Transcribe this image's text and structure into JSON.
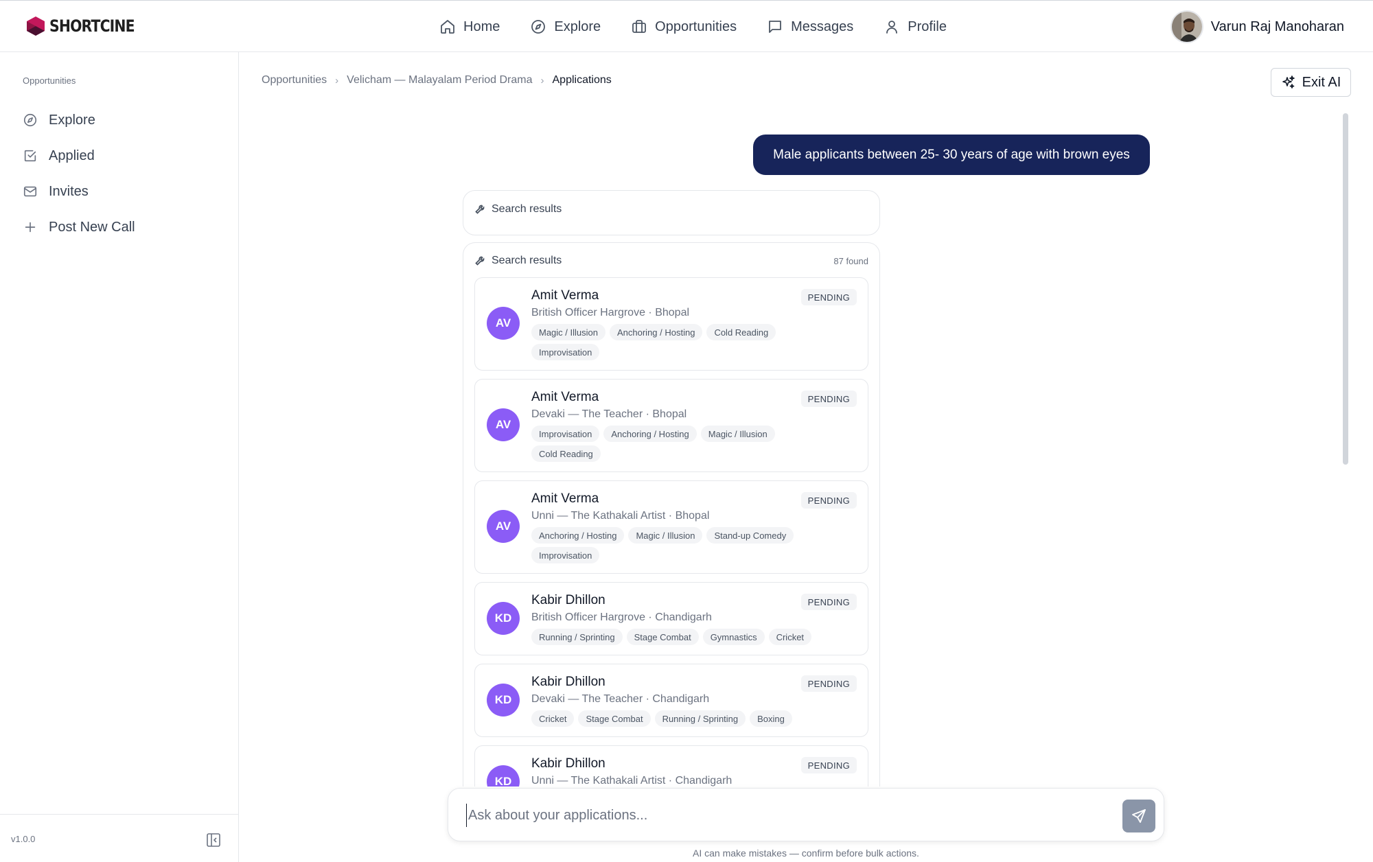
{
  "brand": {
    "name": "SHORTCINE"
  },
  "nav": {
    "items": [
      {
        "label": "Home",
        "icon": "home-icon"
      },
      {
        "label": "Explore",
        "icon": "compass-icon"
      },
      {
        "label": "Opportunities",
        "icon": "briefcase-icon"
      },
      {
        "label": "Messages",
        "icon": "message-icon"
      },
      {
        "label": "Profile",
        "icon": "user-icon"
      }
    ]
  },
  "user": {
    "name": "Varun Raj Manoharan"
  },
  "sidebar": {
    "heading": "Opportunities",
    "items": [
      {
        "label": "Explore",
        "icon": "compass-icon"
      },
      {
        "label": "Applied",
        "icon": "check-square-icon"
      },
      {
        "label": "Invites",
        "icon": "mail-icon"
      },
      {
        "label": "Post New Call",
        "icon": "plus-icon"
      }
    ],
    "version": "v1.0.0"
  },
  "breadcrumb": {
    "items": [
      "Opportunities",
      "Velicham — Malayalam Period Drama",
      "Applications"
    ]
  },
  "exit_ai": {
    "label": "Exit AI"
  },
  "chat": {
    "user_message": "Male applicants between 25- 30 years of age with brown eyes",
    "tool_call_label": "Search results",
    "results": {
      "label": "Search results",
      "count": "87 found",
      "applicants": [
        {
          "initials": "AV",
          "name": "Amit Verma",
          "role": "British Officer Hargrove · Bhopal",
          "status": "PENDING",
          "tags": [
            "Magic / Illusion",
            "Anchoring / Hosting",
            "Cold Reading",
            "Improvisation"
          ]
        },
        {
          "initials": "AV",
          "name": "Amit Verma",
          "role": "Devaki — The Teacher · Bhopal",
          "status": "PENDING",
          "tags": [
            "Improvisation",
            "Anchoring / Hosting",
            "Magic / Illusion",
            "Cold Reading"
          ]
        },
        {
          "initials": "AV",
          "name": "Amit Verma",
          "role": "Unni — The Kathakali Artist · Bhopal",
          "status": "PENDING",
          "tags": [
            "Anchoring / Hosting",
            "Magic / Illusion",
            "Stand-up Comedy",
            "Improvisation"
          ]
        },
        {
          "initials": "KD",
          "name": "Kabir Dhillon",
          "role": "British Officer Hargrove · Chandigarh",
          "status": "PENDING",
          "tags": [
            "Running / Sprinting",
            "Stage Combat",
            "Gymnastics",
            "Cricket"
          ]
        },
        {
          "initials": "KD",
          "name": "Kabir Dhillon",
          "role": "Devaki — The Teacher · Chandigarh",
          "status": "PENDING",
          "tags": [
            "Cricket",
            "Stage Combat",
            "Running / Sprinting",
            "Boxing"
          ]
        },
        {
          "initials": "KD",
          "name": "Kabir Dhillon",
          "role": "Unni — The Kathakali Artist · Chandigarh",
          "status": "PENDING",
          "tags": []
        }
      ]
    }
  },
  "composer": {
    "placeholder": "Ask about your applications...",
    "value": "",
    "disclaimer": "AI can make mistakes — confirm before bulk actions."
  },
  "colors": {
    "accent_navy": "#17245a",
    "avatar_purple": "#8b5cf6",
    "logo_magenta": "#c2185b"
  }
}
